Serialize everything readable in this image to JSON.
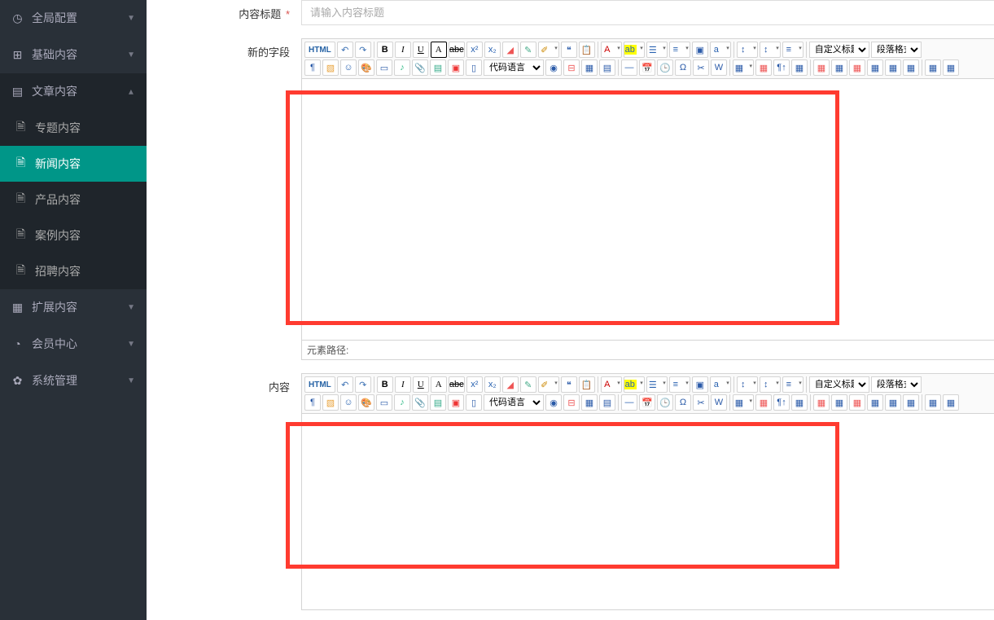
{
  "sidebar": {
    "items": [
      {
        "icon": "globe",
        "label": "全局配置",
        "sub": null
      },
      {
        "icon": "puzzle",
        "label": "基础内容",
        "sub": null
      },
      {
        "icon": "doc",
        "label": "文章内容",
        "expanded": true,
        "sub": [
          {
            "label": "专题内容",
            "active": false
          },
          {
            "label": "新闻内容",
            "active": true
          },
          {
            "label": "产品内容",
            "active": false
          },
          {
            "label": "案例内容",
            "active": false
          },
          {
            "label": "招聘内容",
            "active": false
          }
        ]
      },
      {
        "icon": "grid",
        "label": "扩展内容",
        "sub": null
      },
      {
        "icon": "user",
        "label": "会员中心",
        "sub": null
      },
      {
        "icon": "gear",
        "label": "系统管理",
        "sub": null
      }
    ]
  },
  "form": {
    "title_label": "内容标题",
    "title_required": "*",
    "title_placeholder": "请输入内容标题",
    "field1_label": "新的字段",
    "field2_label": "内容",
    "status_label": "元素路径:"
  },
  "editor": {
    "html_btn": "HTML",
    "code_lang_label": "代码语言",
    "custom_title": "自定义标题",
    "para_format": "段落格式"
  }
}
